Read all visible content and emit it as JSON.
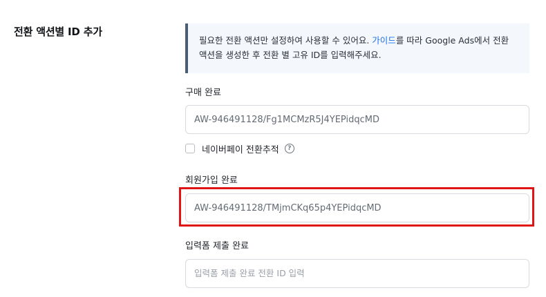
{
  "section": {
    "title": "전환 액션별 ID 추가"
  },
  "notice": {
    "text_before_link": "필요한 전환 액션만 설정하여 사용할 수 있어요. ",
    "link": "가이드",
    "text_after_link": "를 따라 Google Ads에서 전환 액션을 생성한 후 전환 별 고유 ID를 입력해주세요."
  },
  "fields": {
    "purchase": {
      "label": "구매 완료",
      "value": "AW-946491128/Fg1MCMzR5J4YEPidqcMD"
    },
    "naverpay": {
      "label": "네이버페이 전환추적",
      "checked": false,
      "help_icon": "question-circle-icon"
    },
    "signup": {
      "label": "회원가입 완료",
      "value": "AW-946491128/TMjmCKq65p4YEPidqcMD"
    },
    "form_submit": {
      "label": "입력폼 제출 완료",
      "value": "",
      "placeholder": "입력폼 제출 완료 전환 ID 입력"
    }
  },
  "colors": {
    "highlight": "#e01414",
    "link": "#1a73e8",
    "notice_bg": "#f4f7fc",
    "notice_border": "#4a5d73"
  }
}
